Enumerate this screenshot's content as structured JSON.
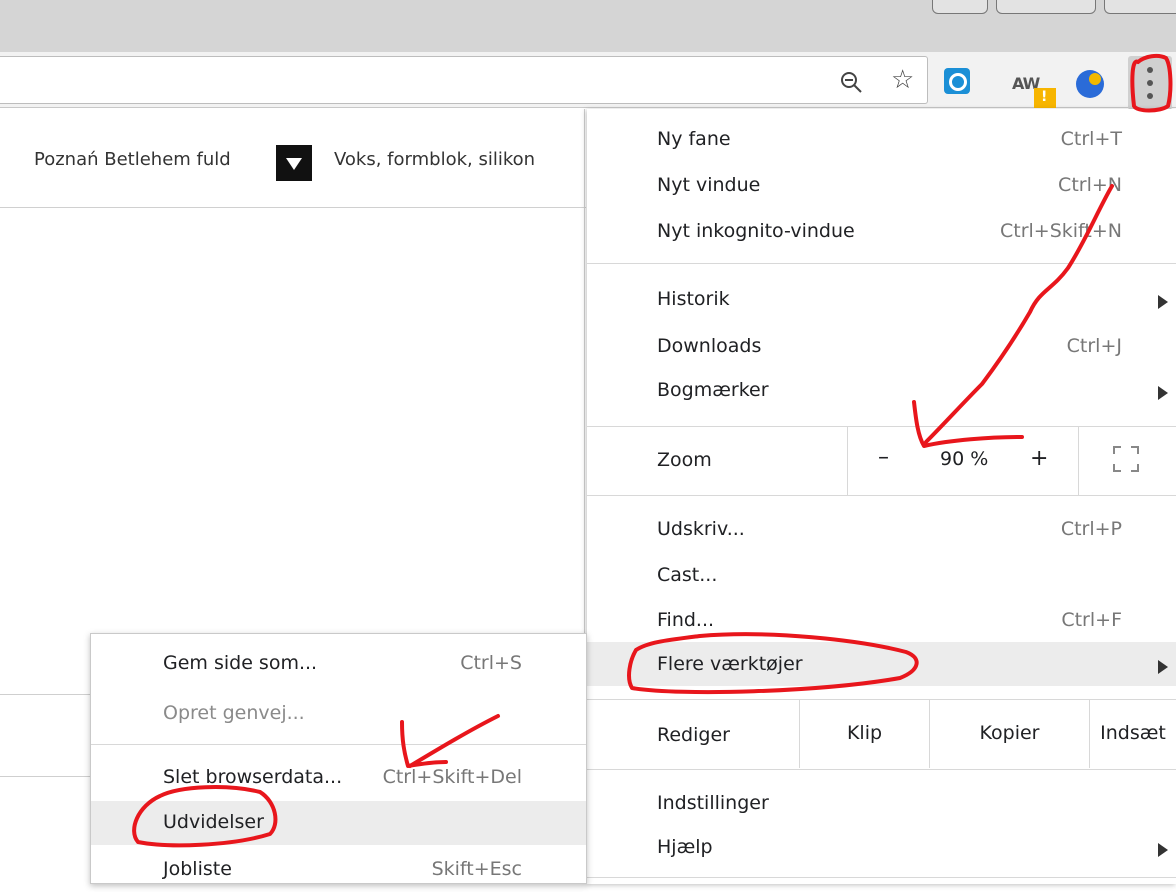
{
  "toolbar": {
    "zoom_icon": "zoom-out-icon",
    "bookmark_icon": "star-icon",
    "extension2_text": "AW",
    "menu_icon": "three-dots-vertical-icon"
  },
  "bookmarks": {
    "item1": "Poznań Betlehem fuld",
    "item2": "Voks, formblok, silikon"
  },
  "main_menu": {
    "new_tab": {
      "label": "Ny fane",
      "shortcut": "Ctrl+T"
    },
    "new_window": {
      "label": "Nyt vindue",
      "shortcut": "Ctrl+N"
    },
    "incognito": {
      "label": "Nyt inkognito-vindue",
      "shortcut": "Ctrl+Skift+N"
    },
    "history": {
      "label": "Historik"
    },
    "downloads": {
      "label": "Downloads",
      "shortcut": "Ctrl+J"
    },
    "bookmarks": {
      "label": "Bogmærker"
    },
    "zoom": {
      "label": "Zoom",
      "minus": "–",
      "value": "90 %",
      "plus": "+"
    },
    "print": {
      "label": "Udskriv...",
      "shortcut": "Ctrl+P"
    },
    "cast": {
      "label": "Cast..."
    },
    "find": {
      "label": "Find...",
      "shortcut": "Ctrl+F"
    },
    "more_tools": {
      "label": "Flere værktøjer"
    },
    "edit": {
      "label": "Rediger",
      "cut": "Klip",
      "copy": "Kopier",
      "paste": "Indsæt"
    },
    "settings": {
      "label": "Indstillinger"
    },
    "help": {
      "label": "Hjælp"
    }
  },
  "sub_menu": {
    "save_page": {
      "label": "Gem side som...",
      "shortcut": "Ctrl+S"
    },
    "create_shortcut": {
      "label": "Opret genvej..."
    },
    "clear_data": {
      "label": "Slet browserdata...",
      "shortcut": "Ctrl+Skift+Del"
    },
    "extensions": {
      "label": "Udvidelser"
    },
    "task_manager": {
      "label": "Jobliste",
      "shortcut": "Skift+Esc"
    }
  },
  "colors": {
    "annotation_red": "#e8161c",
    "menu_highlight": "#ececec"
  }
}
